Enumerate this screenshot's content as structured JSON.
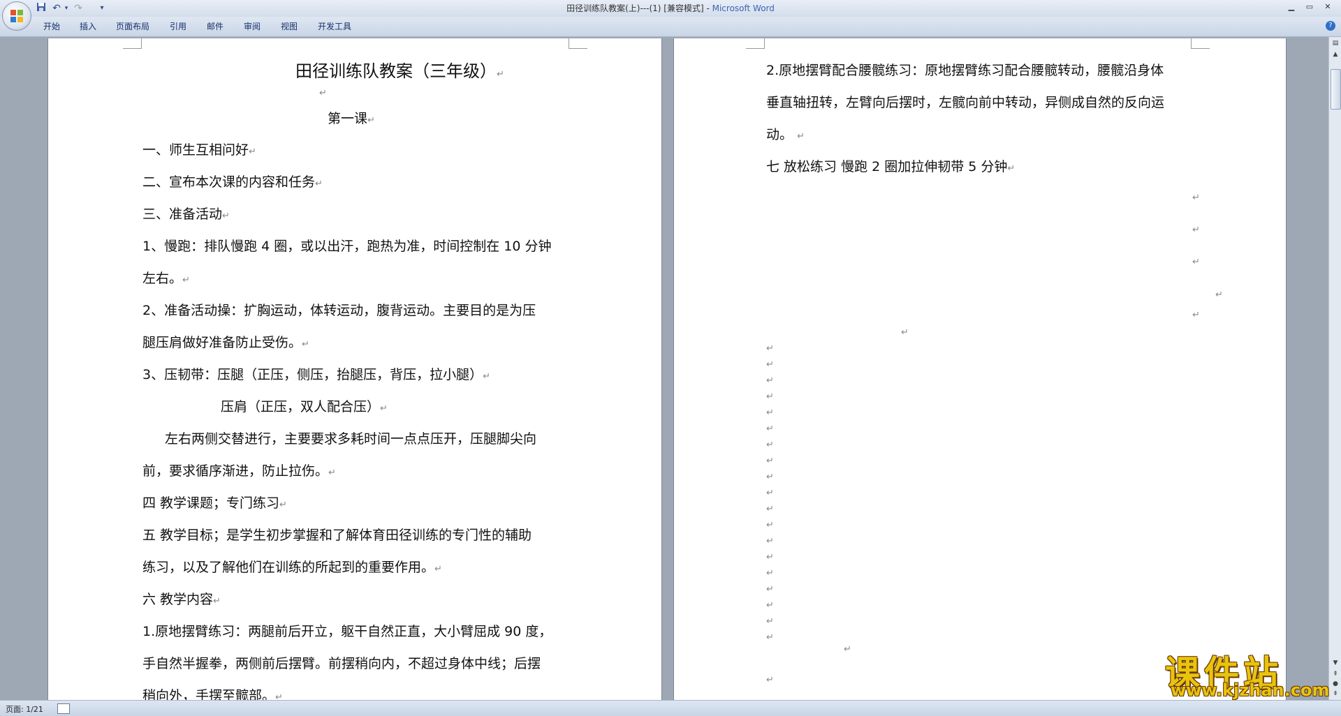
{
  "window": {
    "title_doc": "田径训练队教案(上)---(1) [兼容模式] - ",
    "title_app": "Microsoft Word",
    "minimize": "▁",
    "restore": "▭",
    "close": "✕"
  },
  "quick_access": {
    "save_icon": "save-icon",
    "undo_icon": "undo-icon",
    "redo_icon": "redo-icon",
    "customize": "▾"
  },
  "ribbon": {
    "tabs": [
      "开始",
      "插入",
      "页面布局",
      "引用",
      "邮件",
      "审阅",
      "视图",
      "开发工具"
    ],
    "help": "?"
  },
  "paragraph_mark": "↵",
  "page1": {
    "title": "田径训练队教案（三年级）",
    "lesson": "第一课",
    "lines": [
      "一、师生互相问好",
      "二、宣布本次课的内容和任务",
      "三、准备活动",
      "1、慢跑：排队慢跑 4 圈，或以出汗，跑热为准，时间控制在 10 分钟",
      "左右。",
      "2、准备活动操：扩胸运动，体转运动，腹背运动。主要目的是为压",
      "腿压肩做好准备防止受伤。",
      "3、压韧带：压腿（正压，侧压，抬腿压，背压，拉小腿）",
      "压肩（正压，双人配合压）",
      "左右两侧交替进行，主要要求多耗时间一点点压开，压腿脚尖向",
      "前，要求循序渐进，防止拉伤。",
      "四  教学课题；专门练习",
      "五  教学目标；是学生初步掌握和了解体育田径训练的专门性的辅助",
      "练习，以及了解他们在训练的所起到的重要作用。",
      "六  教学内容",
      "1.原地摆臂练习：两腿前后开立，躯干自然正直，大小臂屈成 90 度，",
      "手自然半握拳，两侧前后摆臂。前摆稍向内，不超过身体中线；后摆",
      "稍向外，手摆至髋部。"
    ]
  },
  "page2": {
    "lines": [
      "2.原地摆臂配合腰髋练习：原地摆臂练习配合腰髋转动，腰髋沿身体",
      "垂直轴扭转，左臂向后摆时，左髋向前中转动，异侧成自然的反向运",
      "动。",
      "七  放松练习    慢跑 2 圈加拉伸韧带 5 分钟"
    ]
  },
  "status": {
    "page": "页面: 1/21"
  },
  "watermark": {
    "text": "课件站",
    "url": "www.kjzhan.com"
  }
}
